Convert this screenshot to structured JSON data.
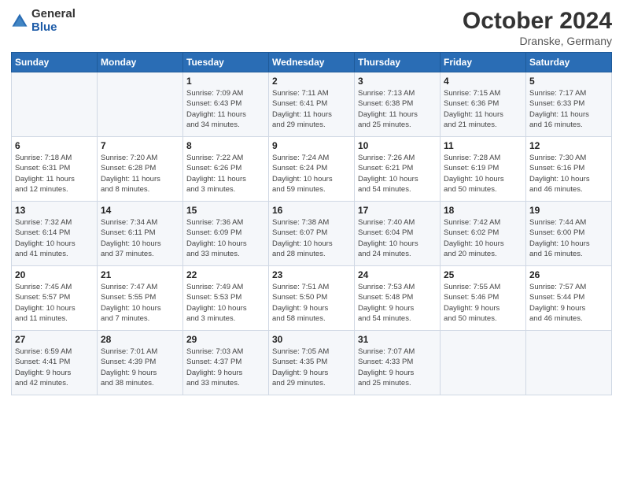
{
  "logo": {
    "general": "General",
    "blue": "Blue"
  },
  "header": {
    "month": "October 2024",
    "location": "Dranske, Germany"
  },
  "weekdays": [
    "Sunday",
    "Monday",
    "Tuesday",
    "Wednesday",
    "Thursday",
    "Friday",
    "Saturday"
  ],
  "weeks": [
    [
      {
        "day": "",
        "info": ""
      },
      {
        "day": "",
        "info": ""
      },
      {
        "day": "1",
        "info": "Sunrise: 7:09 AM\nSunset: 6:43 PM\nDaylight: 11 hours\nand 34 minutes."
      },
      {
        "day": "2",
        "info": "Sunrise: 7:11 AM\nSunset: 6:41 PM\nDaylight: 11 hours\nand 29 minutes."
      },
      {
        "day": "3",
        "info": "Sunrise: 7:13 AM\nSunset: 6:38 PM\nDaylight: 11 hours\nand 25 minutes."
      },
      {
        "day": "4",
        "info": "Sunrise: 7:15 AM\nSunset: 6:36 PM\nDaylight: 11 hours\nand 21 minutes."
      },
      {
        "day": "5",
        "info": "Sunrise: 7:17 AM\nSunset: 6:33 PM\nDaylight: 11 hours\nand 16 minutes."
      }
    ],
    [
      {
        "day": "6",
        "info": "Sunrise: 7:18 AM\nSunset: 6:31 PM\nDaylight: 11 hours\nand 12 minutes."
      },
      {
        "day": "7",
        "info": "Sunrise: 7:20 AM\nSunset: 6:28 PM\nDaylight: 11 hours\nand 8 minutes."
      },
      {
        "day": "8",
        "info": "Sunrise: 7:22 AM\nSunset: 6:26 PM\nDaylight: 11 hours\nand 3 minutes."
      },
      {
        "day": "9",
        "info": "Sunrise: 7:24 AM\nSunset: 6:24 PM\nDaylight: 10 hours\nand 59 minutes."
      },
      {
        "day": "10",
        "info": "Sunrise: 7:26 AM\nSunset: 6:21 PM\nDaylight: 10 hours\nand 54 minutes."
      },
      {
        "day": "11",
        "info": "Sunrise: 7:28 AM\nSunset: 6:19 PM\nDaylight: 10 hours\nand 50 minutes."
      },
      {
        "day": "12",
        "info": "Sunrise: 7:30 AM\nSunset: 6:16 PM\nDaylight: 10 hours\nand 46 minutes."
      }
    ],
    [
      {
        "day": "13",
        "info": "Sunrise: 7:32 AM\nSunset: 6:14 PM\nDaylight: 10 hours\nand 41 minutes."
      },
      {
        "day": "14",
        "info": "Sunrise: 7:34 AM\nSunset: 6:11 PM\nDaylight: 10 hours\nand 37 minutes."
      },
      {
        "day": "15",
        "info": "Sunrise: 7:36 AM\nSunset: 6:09 PM\nDaylight: 10 hours\nand 33 minutes."
      },
      {
        "day": "16",
        "info": "Sunrise: 7:38 AM\nSunset: 6:07 PM\nDaylight: 10 hours\nand 28 minutes."
      },
      {
        "day": "17",
        "info": "Sunrise: 7:40 AM\nSunset: 6:04 PM\nDaylight: 10 hours\nand 24 minutes."
      },
      {
        "day": "18",
        "info": "Sunrise: 7:42 AM\nSunset: 6:02 PM\nDaylight: 10 hours\nand 20 minutes."
      },
      {
        "day": "19",
        "info": "Sunrise: 7:44 AM\nSunset: 6:00 PM\nDaylight: 10 hours\nand 16 minutes."
      }
    ],
    [
      {
        "day": "20",
        "info": "Sunrise: 7:45 AM\nSunset: 5:57 PM\nDaylight: 10 hours\nand 11 minutes."
      },
      {
        "day": "21",
        "info": "Sunrise: 7:47 AM\nSunset: 5:55 PM\nDaylight: 10 hours\nand 7 minutes."
      },
      {
        "day": "22",
        "info": "Sunrise: 7:49 AM\nSunset: 5:53 PM\nDaylight: 10 hours\nand 3 minutes."
      },
      {
        "day": "23",
        "info": "Sunrise: 7:51 AM\nSunset: 5:50 PM\nDaylight: 9 hours\nand 58 minutes."
      },
      {
        "day": "24",
        "info": "Sunrise: 7:53 AM\nSunset: 5:48 PM\nDaylight: 9 hours\nand 54 minutes."
      },
      {
        "day": "25",
        "info": "Sunrise: 7:55 AM\nSunset: 5:46 PM\nDaylight: 9 hours\nand 50 minutes."
      },
      {
        "day": "26",
        "info": "Sunrise: 7:57 AM\nSunset: 5:44 PM\nDaylight: 9 hours\nand 46 minutes."
      }
    ],
    [
      {
        "day": "27",
        "info": "Sunrise: 6:59 AM\nSunset: 4:41 PM\nDaylight: 9 hours\nand 42 minutes."
      },
      {
        "day": "28",
        "info": "Sunrise: 7:01 AM\nSunset: 4:39 PM\nDaylight: 9 hours\nand 38 minutes."
      },
      {
        "day": "29",
        "info": "Sunrise: 7:03 AM\nSunset: 4:37 PM\nDaylight: 9 hours\nand 33 minutes."
      },
      {
        "day": "30",
        "info": "Sunrise: 7:05 AM\nSunset: 4:35 PM\nDaylight: 9 hours\nand 29 minutes."
      },
      {
        "day": "31",
        "info": "Sunrise: 7:07 AM\nSunset: 4:33 PM\nDaylight: 9 hours\nand 25 minutes."
      },
      {
        "day": "",
        "info": ""
      },
      {
        "day": "",
        "info": ""
      }
    ]
  ]
}
